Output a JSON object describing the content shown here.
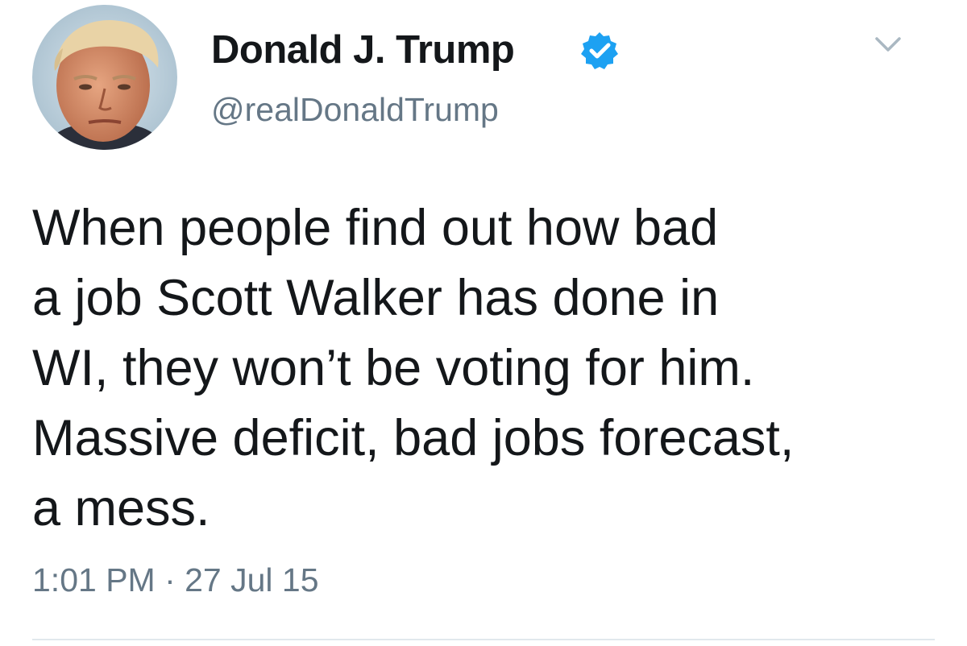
{
  "author": {
    "display_name": "Donald J. Trump",
    "handle": "@realDonaldTrump",
    "verified": true,
    "verified_color": "#1da1f2"
  },
  "tweet": {
    "lines": [
      "When people find out how bad",
      "a job Scott Walker has done in",
      "WI, they won’t be voting for him.",
      "Massive deficit, bad jobs forecast,",
      "a mess."
    ],
    "timestamp": "1:01 PM · 27 Jul 15"
  },
  "icons": {
    "verified": "verified-badge-icon",
    "menu": "chevron-down-icon"
  },
  "colors": {
    "text": "#14171a",
    "secondary": "#657786",
    "divider": "#e1e8ed"
  }
}
